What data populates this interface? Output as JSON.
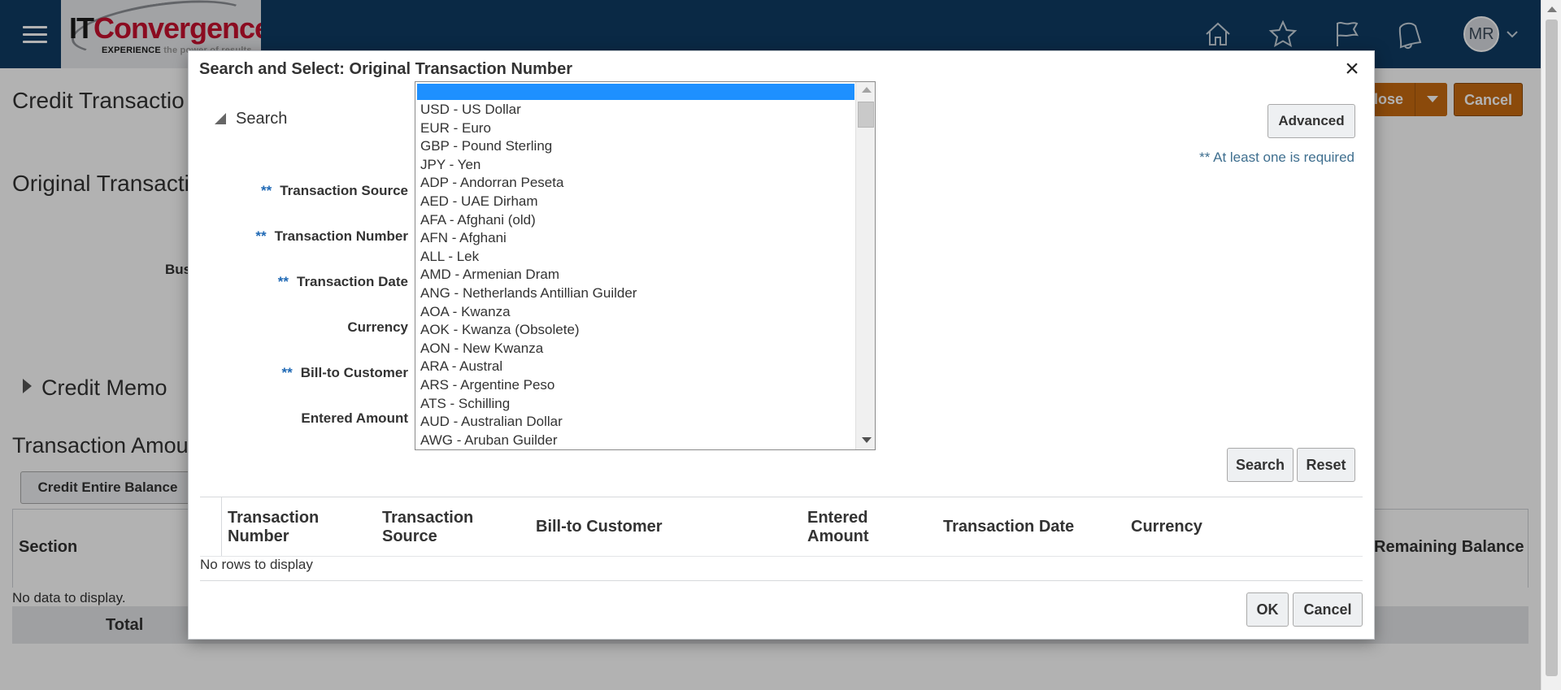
{
  "header": {
    "logo": {
      "it": "IT",
      "convergence": "Convergence",
      "tagline_a": "EXPERIENCE",
      "tagline_b": "the power of results"
    },
    "icons": [
      "home-icon",
      "favorites-star-icon",
      "flag-icon",
      "notifications-bell-icon"
    ],
    "user_initials": "MR"
  },
  "background_page": {
    "title": "Credit Transactio",
    "section": "Original Transactio",
    "bus_label": "Bus",
    "close_button": "lose",
    "cancel_button": "Cancel",
    "credit_memo": "Credit Memo",
    "amounts_title": "Transaction Amou",
    "credit_entire_balance": "Credit Entire Balance",
    "section_header": "Section",
    "remaining_balance_header": "Remaining Balance",
    "no_data": "No data to display.",
    "total": "Total"
  },
  "dialog": {
    "title": "Search and Select: Original Transaction Number",
    "close_symbol": "×",
    "search_header": "Search",
    "advanced_button": "Advanced",
    "required_note": "** At least one is required",
    "required_marker": "**",
    "fields": {
      "transaction_source": "Transaction Source",
      "transaction_number": "Transaction Number",
      "transaction_date": "Transaction Date",
      "currency": "Currency",
      "bill_to_customer": "Bill-to Customer",
      "entered_amount": "Entered Amount"
    },
    "currency_options": [
      "USD - US Dollar",
      "EUR - Euro",
      "GBP - Pound Sterling",
      "JPY - Yen",
      "ADP - Andorran Peseta",
      "AED - UAE Dirham",
      "AFA - Afghani (old)",
      "AFN - Afghani",
      "ALL - Lek",
      "AMD - Armenian Dram",
      "ANG - Netherlands Antillian Guilder",
      "AOA - Kwanza",
      "AOK - Kwanza (Obsolete)",
      "AON - New Kwanza",
      "ARA - Austral",
      "ARS - Argentine Peso",
      "ATS - Schilling",
      "AUD - Australian Dollar",
      "AWG - Aruban Guilder"
    ],
    "search_button": "Search",
    "reset_button": "Reset",
    "results_columns": {
      "transaction_number": [
        "Transaction",
        "Number"
      ],
      "transaction_source": [
        "Transaction",
        "Source"
      ],
      "bill_to_customer": "Bill-to Customer",
      "entered_amount": [
        "Entered",
        "Amount"
      ],
      "transaction_date": "Transaction Date",
      "currency": "Currency"
    },
    "no_rows": "No rows to display",
    "ok_button": "OK",
    "cancel_button": "Cancel"
  },
  "colors": {
    "header_bg": "#0f3c63",
    "accent_orange": "#c86a11",
    "list_selected": "#1e90ff",
    "required_blue": "#1f69b5"
  }
}
